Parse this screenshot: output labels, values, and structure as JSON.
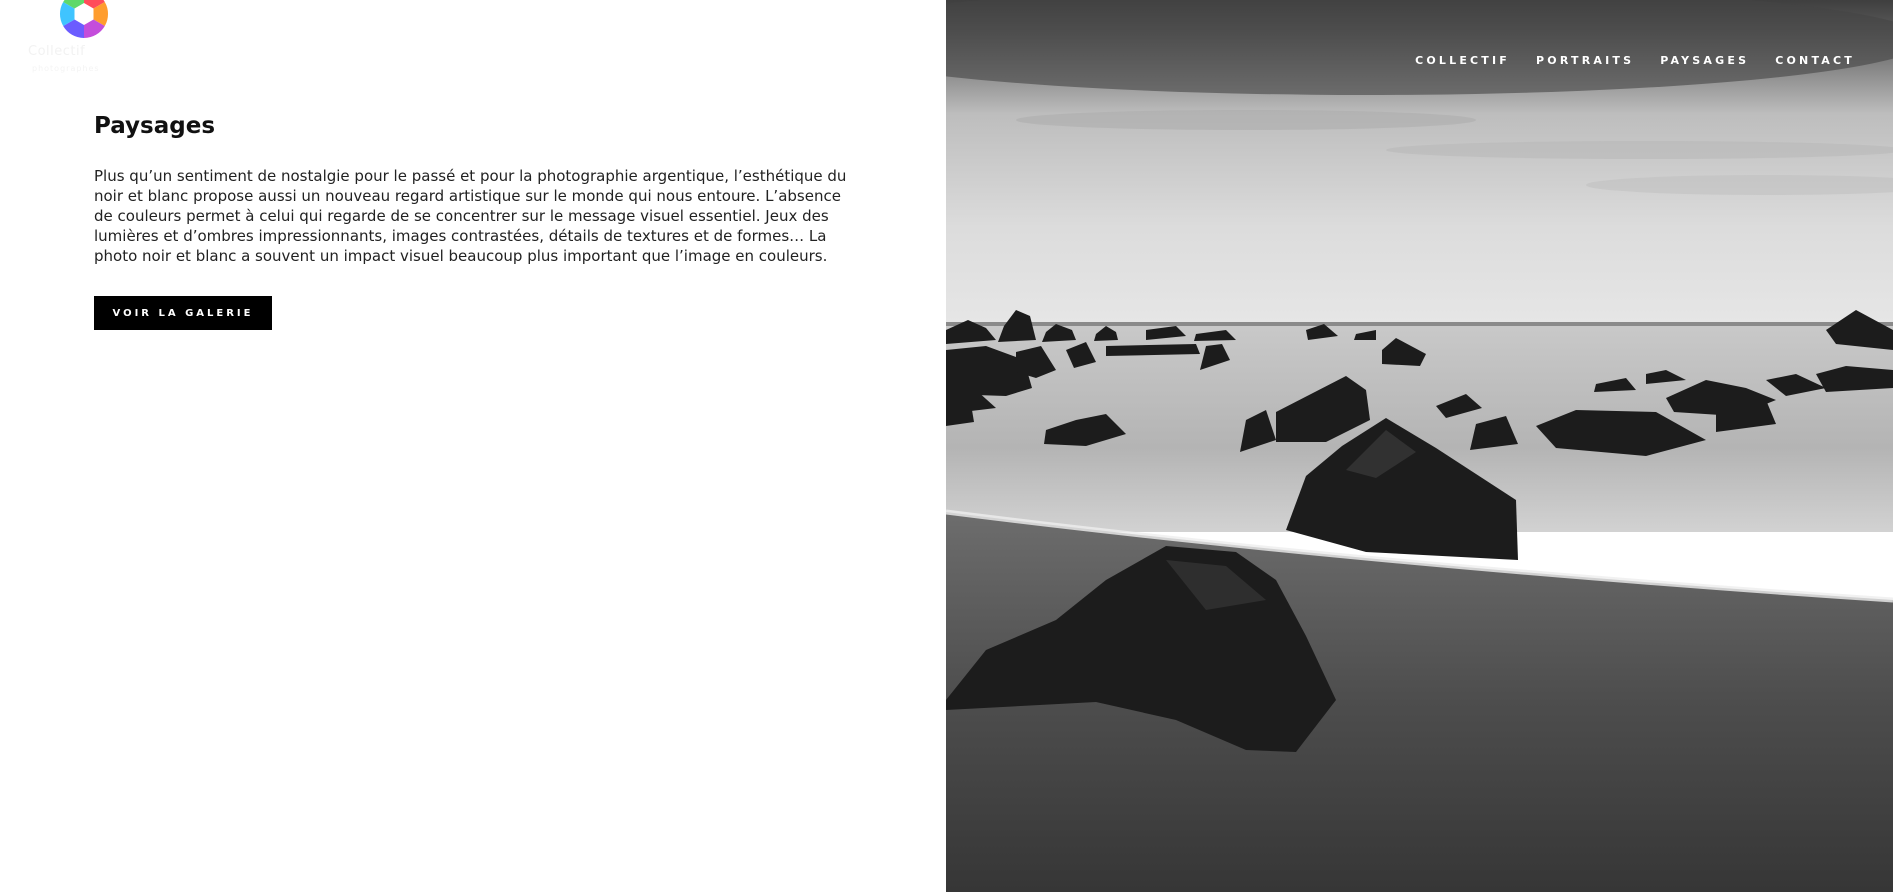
{
  "brand": {
    "logo_icon": "aperture-icon",
    "name": "Collectif",
    "tagline": "photographes"
  },
  "nav": {
    "items": [
      {
        "label": "COLLECTIF"
      },
      {
        "label": "PORTRAITS"
      },
      {
        "label": "PAYSAGES"
      },
      {
        "label": "CONTACT"
      }
    ]
  },
  "main": {
    "title": "Paysages",
    "body": "Plus qu’un sentiment de nostalgie pour le passé et pour la photographie argentique, l’esthétique du noir et blanc propose aussi un nouveau regard artistique sur le monde qui nous entoure. L’absence de couleurs permet à celui qui regarde de se concentrer sur le message visuel essentiel. Jeux des lumières et d’ombres impressionnants, images contrastées, détails de textures et de formes… La photo noir et blanc a souvent un impact visuel beaucoup plus important que l’image en couleurs.",
    "button_label": "VOIR LA GALERIE"
  },
  "hero": {
    "image": "black-and-white-rocky-seascape"
  },
  "colors": {
    "button_bg": "#000000",
    "button_text": "#ffffff",
    "nav_text": "#ffffff",
    "text": "#222222"
  }
}
